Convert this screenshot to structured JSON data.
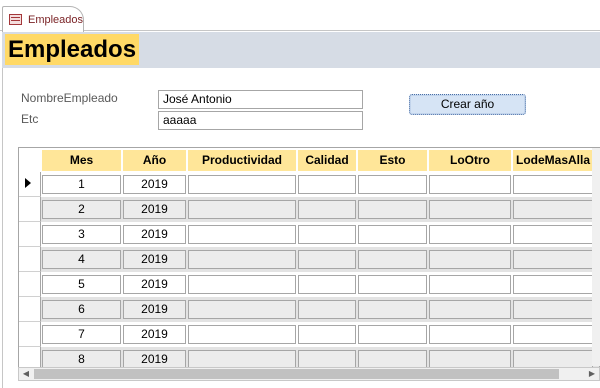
{
  "tab": {
    "label": "Empleados"
  },
  "form": {
    "title": "Empleados",
    "fields": {
      "nombre_label": "NombreEmpleado",
      "nombre_value": "José Antonio",
      "etc_label": "Etc",
      "etc_value": "aaaaa"
    },
    "button_label": "Crear año"
  },
  "grid": {
    "columns": [
      "Mes",
      "Año",
      "Productividad",
      "Calidad",
      "Esto",
      "LoOtro",
      "LodeMasAlla"
    ],
    "rows": [
      {
        "mes": "1",
        "anio": "2019"
      },
      {
        "mes": "2",
        "anio": "2019"
      },
      {
        "mes": "3",
        "anio": "2019"
      },
      {
        "mes": "4",
        "anio": "2019"
      },
      {
        "mes": "5",
        "anio": "2019"
      },
      {
        "mes": "6",
        "anio": "2019"
      },
      {
        "mes": "7",
        "anio": "2019"
      },
      {
        "mes": "8",
        "anio": "2019"
      }
    ]
  },
  "colors": {
    "header_band": "#d6dce5",
    "title_bg": "#ffd966",
    "column_header_bg": "#ffe699",
    "alt_row_bg": "#e3e3e3"
  },
  "icons": [
    "form-icon",
    "record-selector-arrow-icon",
    "scroll-left-icon",
    "scroll-right-icon"
  ]
}
